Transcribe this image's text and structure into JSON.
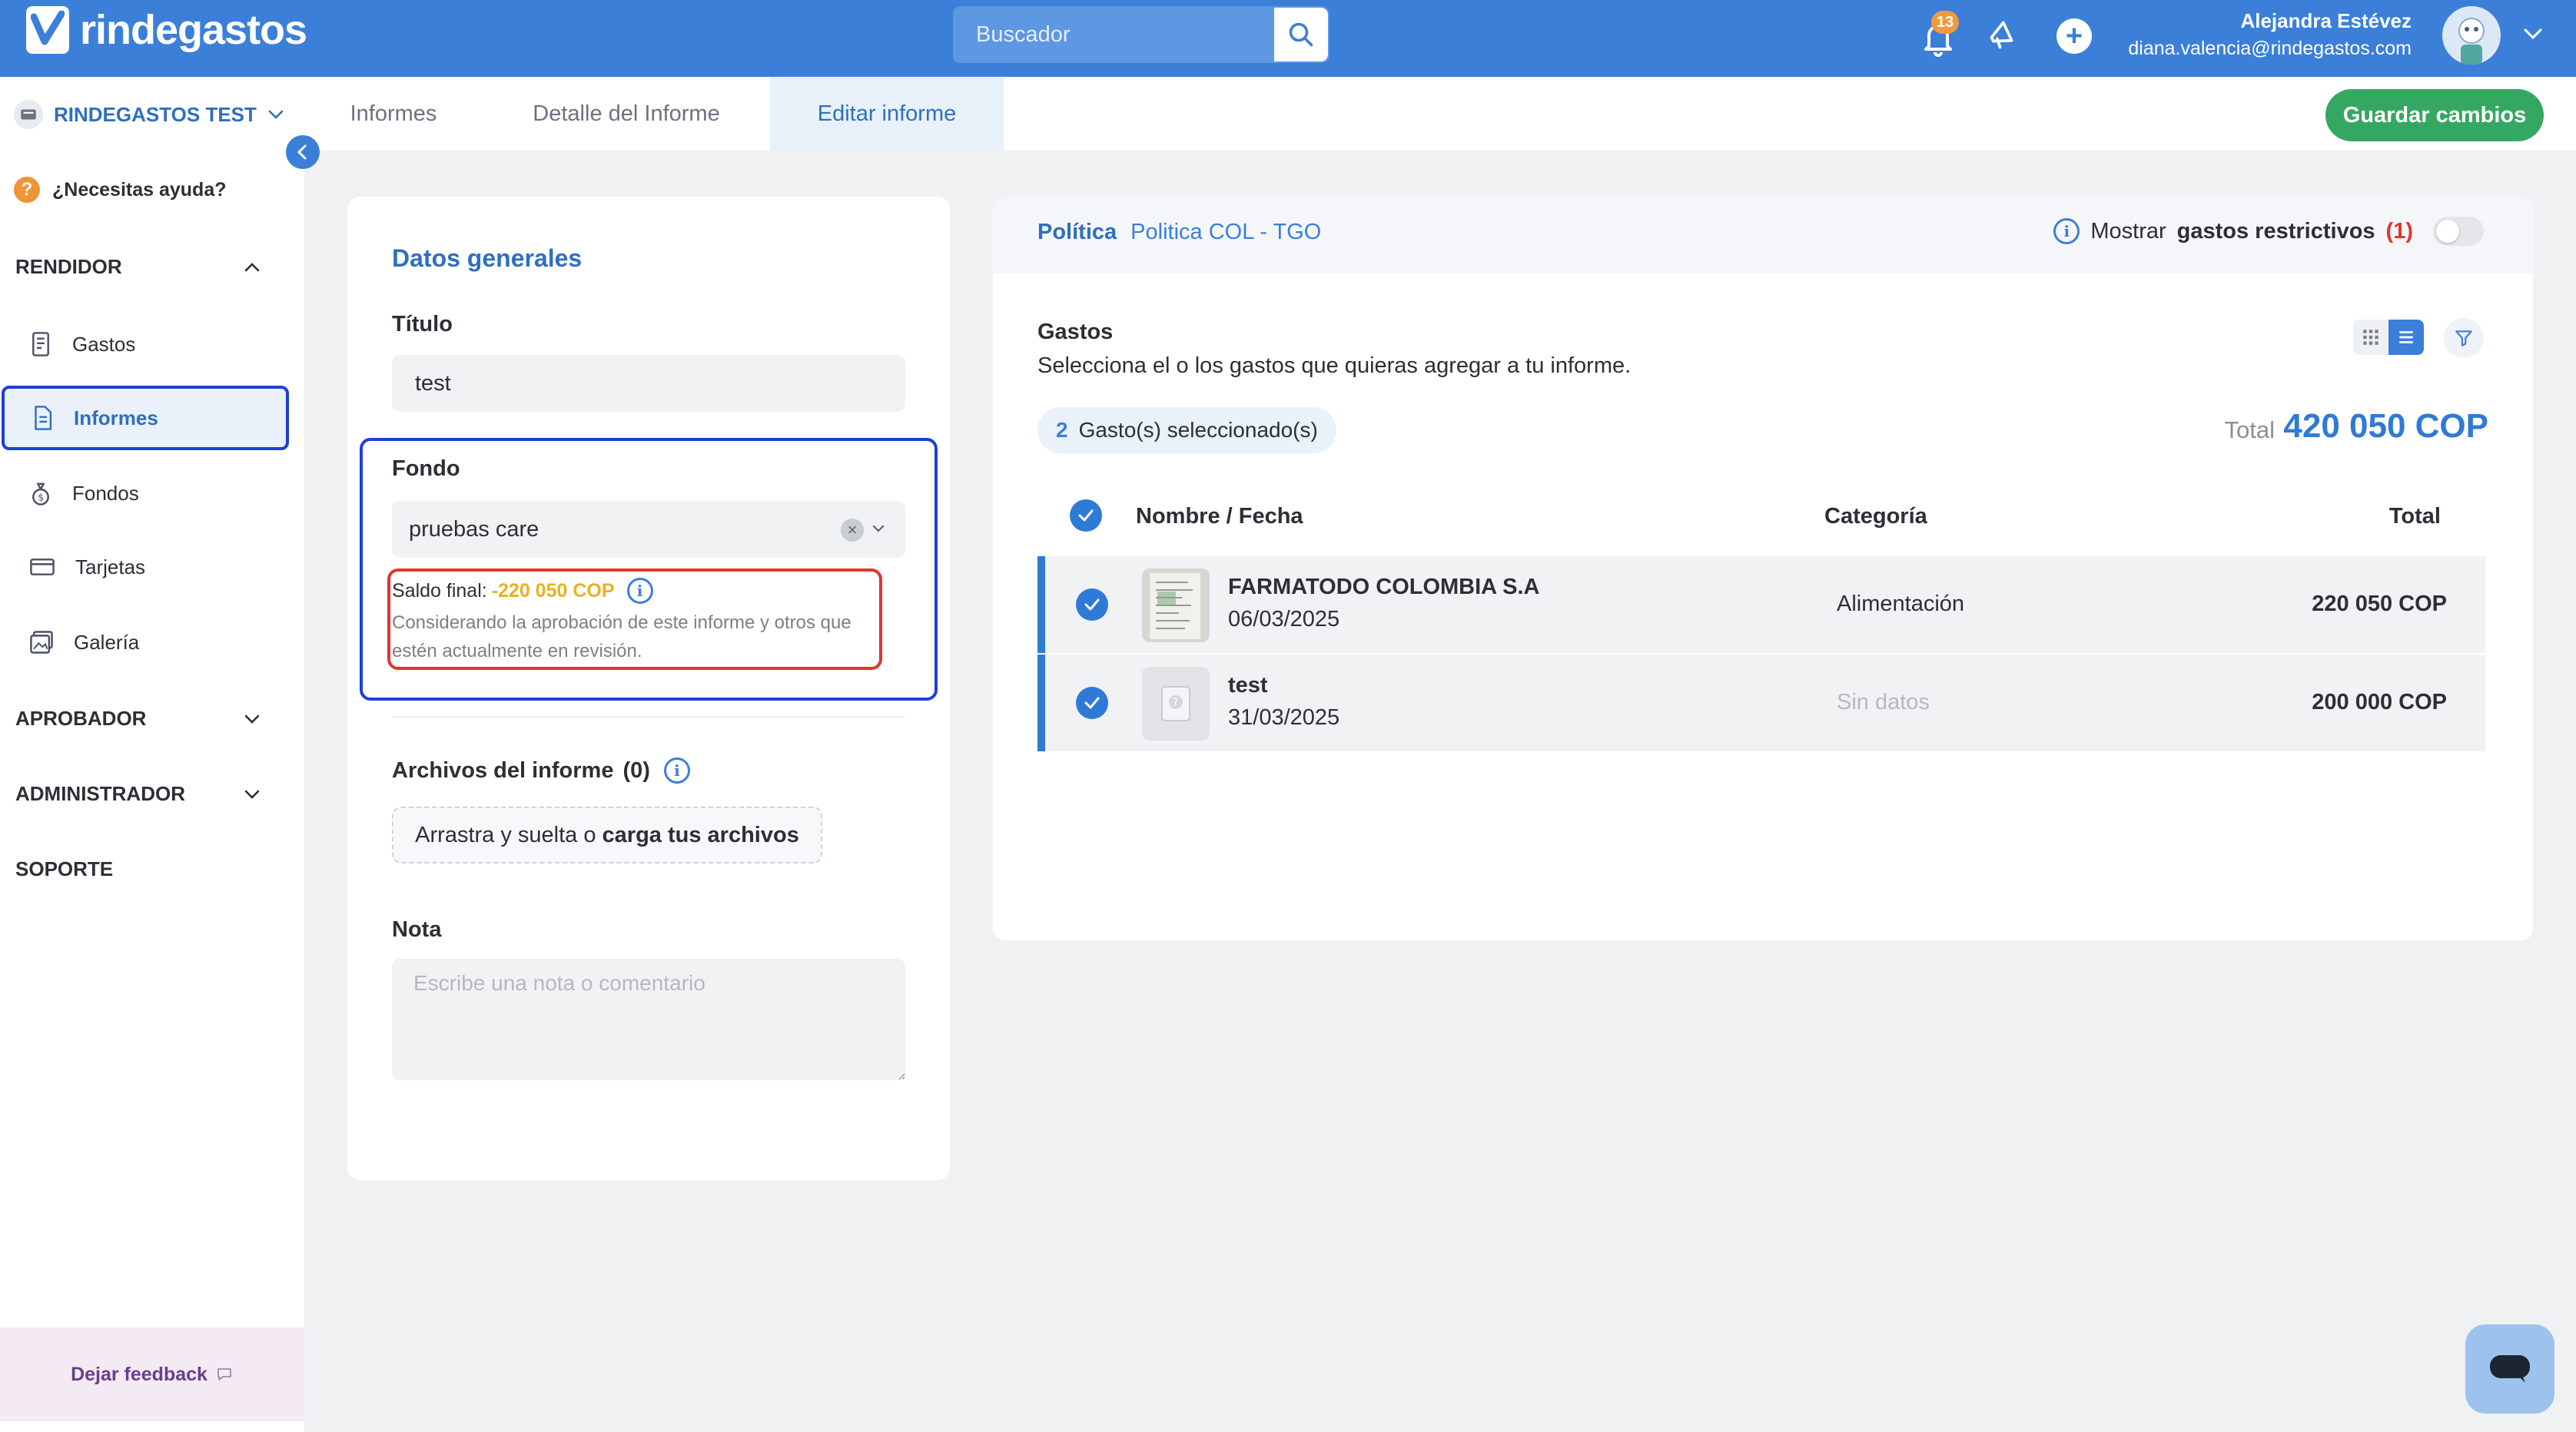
{
  "app": {
    "logo_text": "rindegastos",
    "search_placeholder": "Buscador",
    "notifications_count": "13",
    "user_name": "Alejandra Estévez",
    "user_email": "diana.valencia@rindegastos.com"
  },
  "sidebar": {
    "company": "RINDEGASTOS TEST",
    "help": "¿Necesitas ayuda?",
    "sections": {
      "rendidor": "RENDIDOR",
      "aprobador": "APROBADOR",
      "administrador": "ADMINISTRADOR",
      "soporte": "SOPORTE"
    },
    "items": [
      {
        "label": "Gastos"
      },
      {
        "label": "Informes"
      },
      {
        "label": "Fondos"
      },
      {
        "label": "Tarjetas"
      },
      {
        "label": "Galería"
      }
    ],
    "feedback": "Dejar feedback"
  },
  "tabs": [
    {
      "label": "Informes"
    },
    {
      "label": "Detalle del Informe"
    },
    {
      "label": "Editar informe"
    }
  ],
  "save_button": "Guardar cambios",
  "form": {
    "section_title": "Datos generales",
    "title_label": "Título",
    "title_value": "test",
    "fondo_label": "Fondo",
    "fondo_value": "pruebas care",
    "saldo_label": "Saldo final:",
    "saldo_value": "-220 050 COP",
    "saldo_note": "Considerando la aprobación de este informe y otros que estén actualmente en revisión.",
    "files_label": "Archivos del informe",
    "files_count": "(0)",
    "dropzone_text": "Arrastra y suelta o",
    "dropzone_link": "carga tus archivos",
    "note_label": "Nota",
    "note_placeholder": "Escribe una nota o comentario"
  },
  "expenses": {
    "policy_label": "Política",
    "policy_name": "Politica COL - TGO",
    "restrict_prefix": "Mostrar",
    "restrict_bold": "gastos restrictivos",
    "restrict_count": "(1)",
    "title": "Gastos",
    "subtitle": "Selecciona el o los gastos que quieras agregar a tu informe.",
    "selected_count": "2",
    "selected_text": "Gasto(s) seleccionado(s)",
    "total_label": "Total",
    "total_value": "420 050 COP",
    "columns": {
      "name": "Nombre / Fecha",
      "category": "Categoría",
      "total": "Total"
    },
    "rows": [
      {
        "name": "FARMATODO COLOMBIA S.A",
        "date": "06/03/2025",
        "category": "Alimentación",
        "total": "220 050 COP"
      },
      {
        "name": "test",
        "date": "31/03/2025",
        "category": "Sin datos",
        "total": "200 000 COP"
      }
    ]
  },
  "colors": {
    "primary": "#3b7fd9",
    "save": "#34a862",
    "saldo_negative": "#e7b21f",
    "highlight_blue": "#1f3fd6",
    "highlight_red": "#e0362b"
  }
}
